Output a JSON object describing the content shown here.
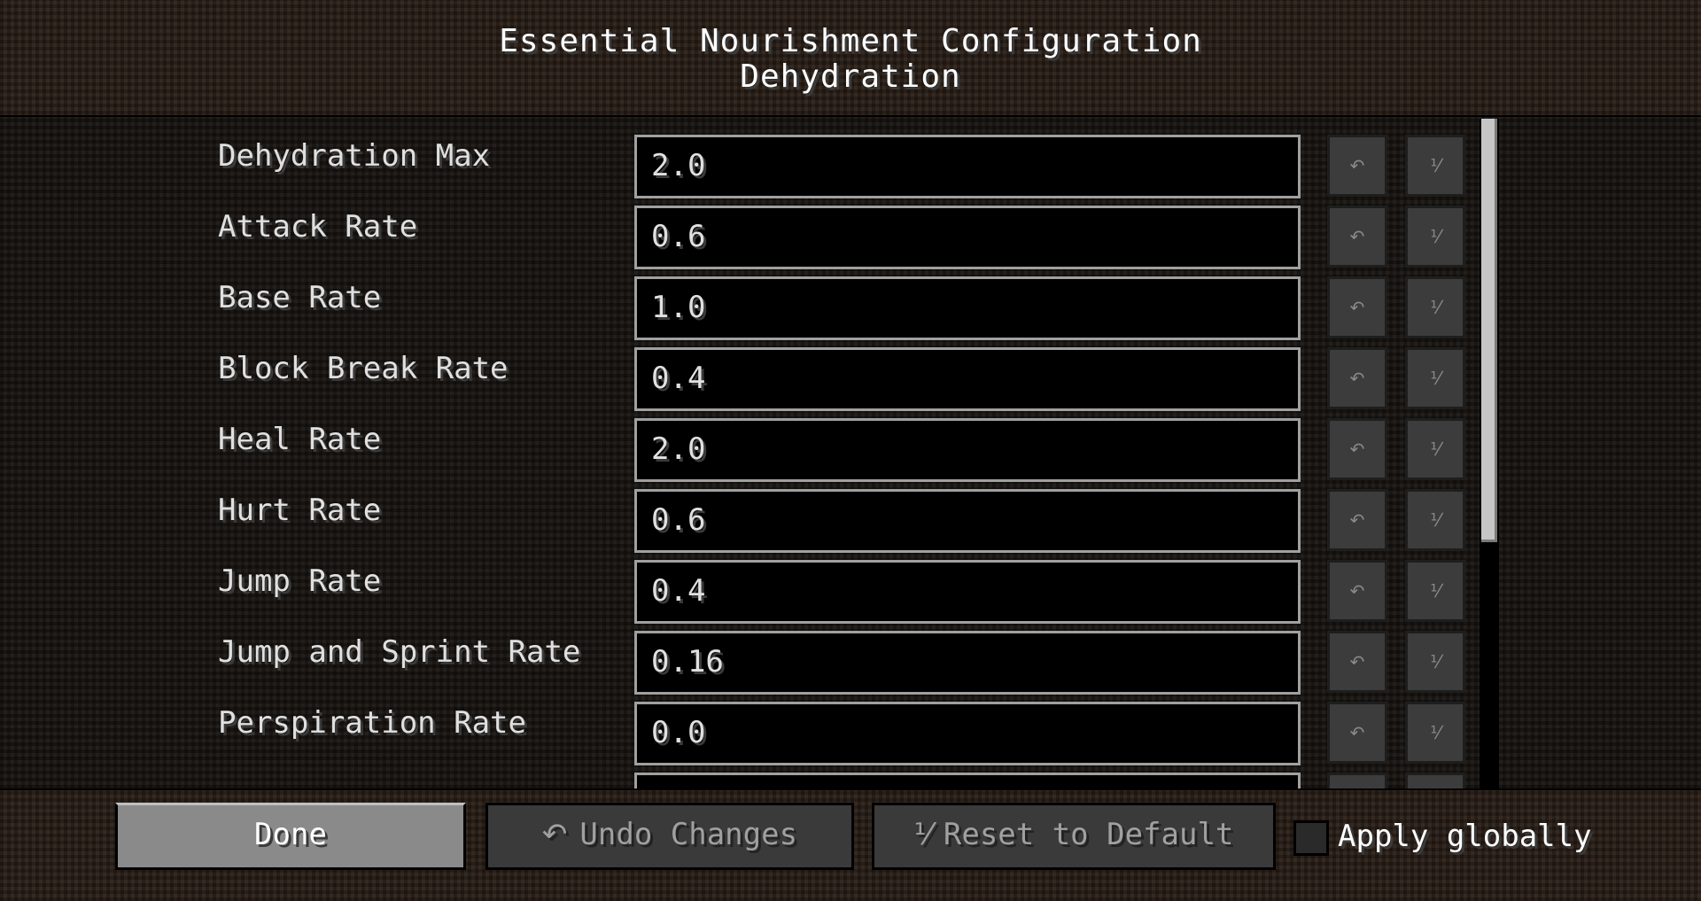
{
  "header": {
    "title": "Essential Nourishment Configuration",
    "subtitle": "Dehydration"
  },
  "icons": {
    "undo": "↶",
    "reset": "⅟"
  },
  "settings": [
    {
      "label": "Dehydration Max",
      "value": "2.0"
    },
    {
      "label": "Attack Rate",
      "value": "0.6"
    },
    {
      "label": "Base Rate",
      "value": "1.0"
    },
    {
      "label": "Block Break Rate",
      "value": "0.4"
    },
    {
      "label": "Heal Rate",
      "value": "2.0"
    },
    {
      "label": "Hurt Rate",
      "value": "0.6"
    },
    {
      "label": "Jump Rate",
      "value": "0.4"
    },
    {
      "label": "Jump and Sprint Rate",
      "value": "0.16"
    },
    {
      "label": "Perspiration Rate",
      "value": "0.0"
    }
  ],
  "footer": {
    "done_label": "Done",
    "undo_label": "Undo Changes",
    "reset_label": "Reset to Default",
    "apply_globally_label": "Apply globally",
    "apply_globally_checked": false
  }
}
